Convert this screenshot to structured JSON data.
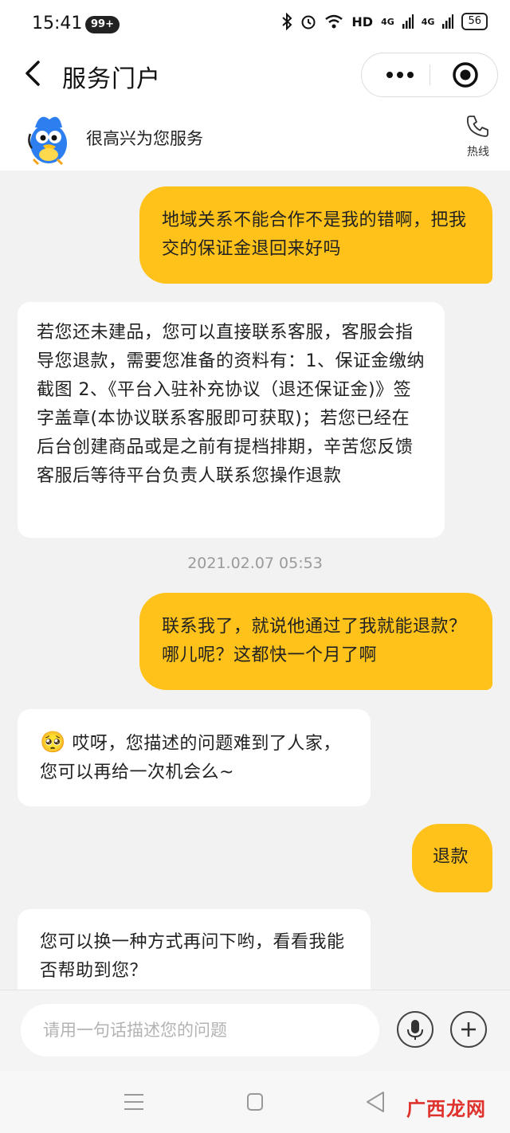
{
  "status_bar": {
    "time": "15:41",
    "notification_badge": "99+",
    "network_label": "HD",
    "signal_1": "4G",
    "signal_2": "4G",
    "battery": "56"
  },
  "nav": {
    "title": "服务门户"
  },
  "service": {
    "welcome": "很高兴为您服务",
    "hotline_label": "热线"
  },
  "messages": [
    {
      "sender": "user",
      "text": "地域关系不能合作不是我的错啊，把我交的保证金退回来好吗"
    },
    {
      "sender": "bot",
      "text": "若您还未建品，您可以直接联系客服，客服会指导您退款，需要您准备的资料有：1、保证金缴纳截图 2、《平台入驻补充协议（退还保证金)》签字盖章(本协议联系客服即可获取)；若您已经在后台创建商品或是之前有提档排期，辛苦您反馈客服后等待平台负责人联系您操作退款"
    },
    {
      "sender": "timestamp",
      "text": "2021.02.07 05:53"
    },
    {
      "sender": "user",
      "text": "联系我了，就说他通过了我就能退款？哪儿呢？这都快一个月了啊"
    },
    {
      "sender": "bot",
      "emoji": "🥺",
      "text": "哎呀，您描述的问题难到了人家，您可以再给一次机会么~"
    },
    {
      "sender": "user",
      "text": "退款"
    },
    {
      "sender": "bot",
      "text": "您可以换一种方式再问下哟，看看我能否帮助到您？"
    }
  ],
  "input": {
    "placeholder": "请用一句话描述您的问题"
  },
  "watermark": "广西龙网",
  "colors": {
    "user_bubble": "#ffc21a",
    "bot_bubble": "#ffffff",
    "background": "#f2f2f2",
    "watermark": "#e0322c"
  }
}
